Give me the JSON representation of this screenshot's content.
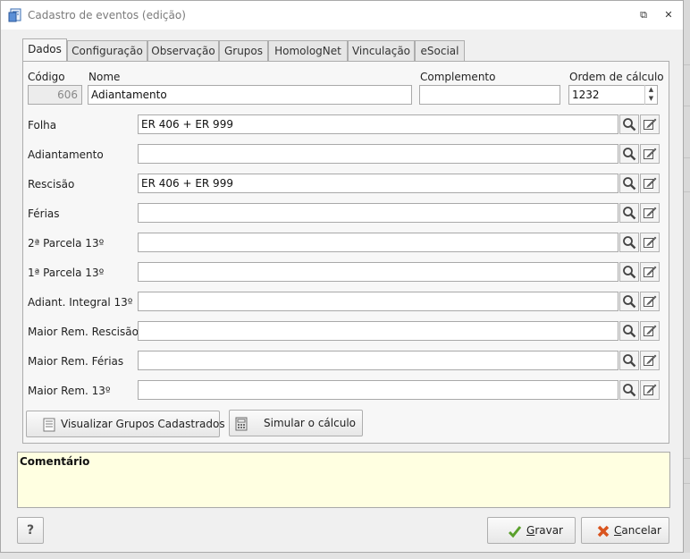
{
  "window": {
    "title": "Cadastro de eventos (edição)",
    "restore_glyph": "⧉",
    "close_glyph": "✕"
  },
  "tabs": [
    "Dados",
    "Configuração",
    "Observação",
    "Grupos",
    "HomologNet",
    "Vinculação",
    "eSocial"
  ],
  "header_fields": {
    "codigo_label": "Código",
    "codigo_value": "606",
    "nome_label": "Nome",
    "nome_value": "Adiantamento",
    "complemento_label": "Complemento",
    "complemento_value": "",
    "ordem_label": "Ordem de cálculo",
    "ordem_value": "1232"
  },
  "rows": [
    {
      "label": "Folha",
      "value": "ER 406 + ER 999"
    },
    {
      "label": "Adiantamento",
      "value": ""
    },
    {
      "label": "Rescisão",
      "value": "ER 406 + ER 999"
    },
    {
      "label": "Férias",
      "value": ""
    },
    {
      "label": "2ª Parcela 13º",
      "value": ""
    },
    {
      "label": "1ª Parcela 13º",
      "value": ""
    },
    {
      "label": "Adiant. Integral 13º",
      "value": ""
    },
    {
      "label": "Maior Rem. Rescisão",
      "value": ""
    },
    {
      "label": "Maior Rem. Férias",
      "value": ""
    },
    {
      "label": "Maior Rem. 13º",
      "value": ""
    }
  ],
  "buttons": {
    "visualizar": "Visualizar Grupos Cadastrados",
    "simular": "Simular o cálculo",
    "help": "?",
    "gravar_first": "G",
    "gravar_rest": "ravar",
    "cancelar_first": "C",
    "cancelar_rest": "ancelar"
  },
  "comment": {
    "label": "Comentário",
    "value": ""
  },
  "colors": {
    "comment_bg": "#ffffe1",
    "gravar_check": "#5aa02c",
    "cancelar_x": "#d9541e"
  },
  "icons": {
    "search": "search-icon",
    "edit": "edit-icon"
  }
}
